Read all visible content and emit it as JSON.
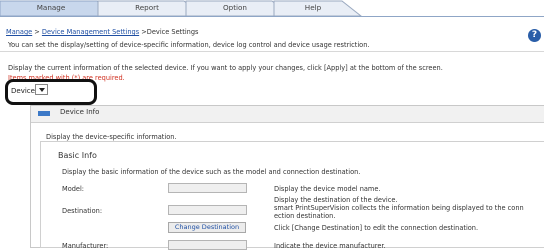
{
  "tabs": [
    {
      "label": "Manage",
      "active": true
    },
    {
      "label": "Report",
      "active": false
    },
    {
      "label": "Option",
      "active": false
    },
    {
      "label": "Help",
      "active": false
    }
  ],
  "breadcrumb": {
    "link1": "Manage",
    "sep1": " > ",
    "link2": "Device Management Settings",
    "sep2": " >",
    "current": "Device Settings"
  },
  "page_description": "You can set the display/setting of device-specific information, device log control and device usage restriction.",
  "instruction": "Display the current information of the selected device. If you want to apply your changes, click [Apply] at the bottom of the screen.",
  "required_note": "Items marked with (*) are required.",
  "help_icon_glyph": "?",
  "device_selector": {
    "label": "Device",
    "selected": ""
  },
  "device_info": {
    "header": "Device Info",
    "description": "Display the device-specific information.",
    "basic_info": {
      "title": "Basic Info",
      "description": "Display the basic information of the device such as the model and connection destination.",
      "rows": {
        "model": {
          "label": "Model:",
          "value": "",
          "help": "Display the device model name."
        },
        "destination": {
          "label": "Destination:",
          "value": "",
          "help_line1": "Display the destination of the device.",
          "help_line2": "smart PrintSuperVision collects the information being displayed to the conn",
          "help_line3": "ection destination."
        },
        "change_destination": {
          "button": "Change Destination",
          "help": "Click [Change Destination] to edit the connection destination."
        },
        "manufacturer": {
          "label": "Manufacturer:",
          "value": "",
          "help": "Indicate the device manufacturer."
        }
      }
    }
  },
  "colors": {
    "link": "#1f4fa3",
    "required": "#d03020",
    "accent_bar": "#3c79c7",
    "help_icon": "#2a5ea8"
  }
}
